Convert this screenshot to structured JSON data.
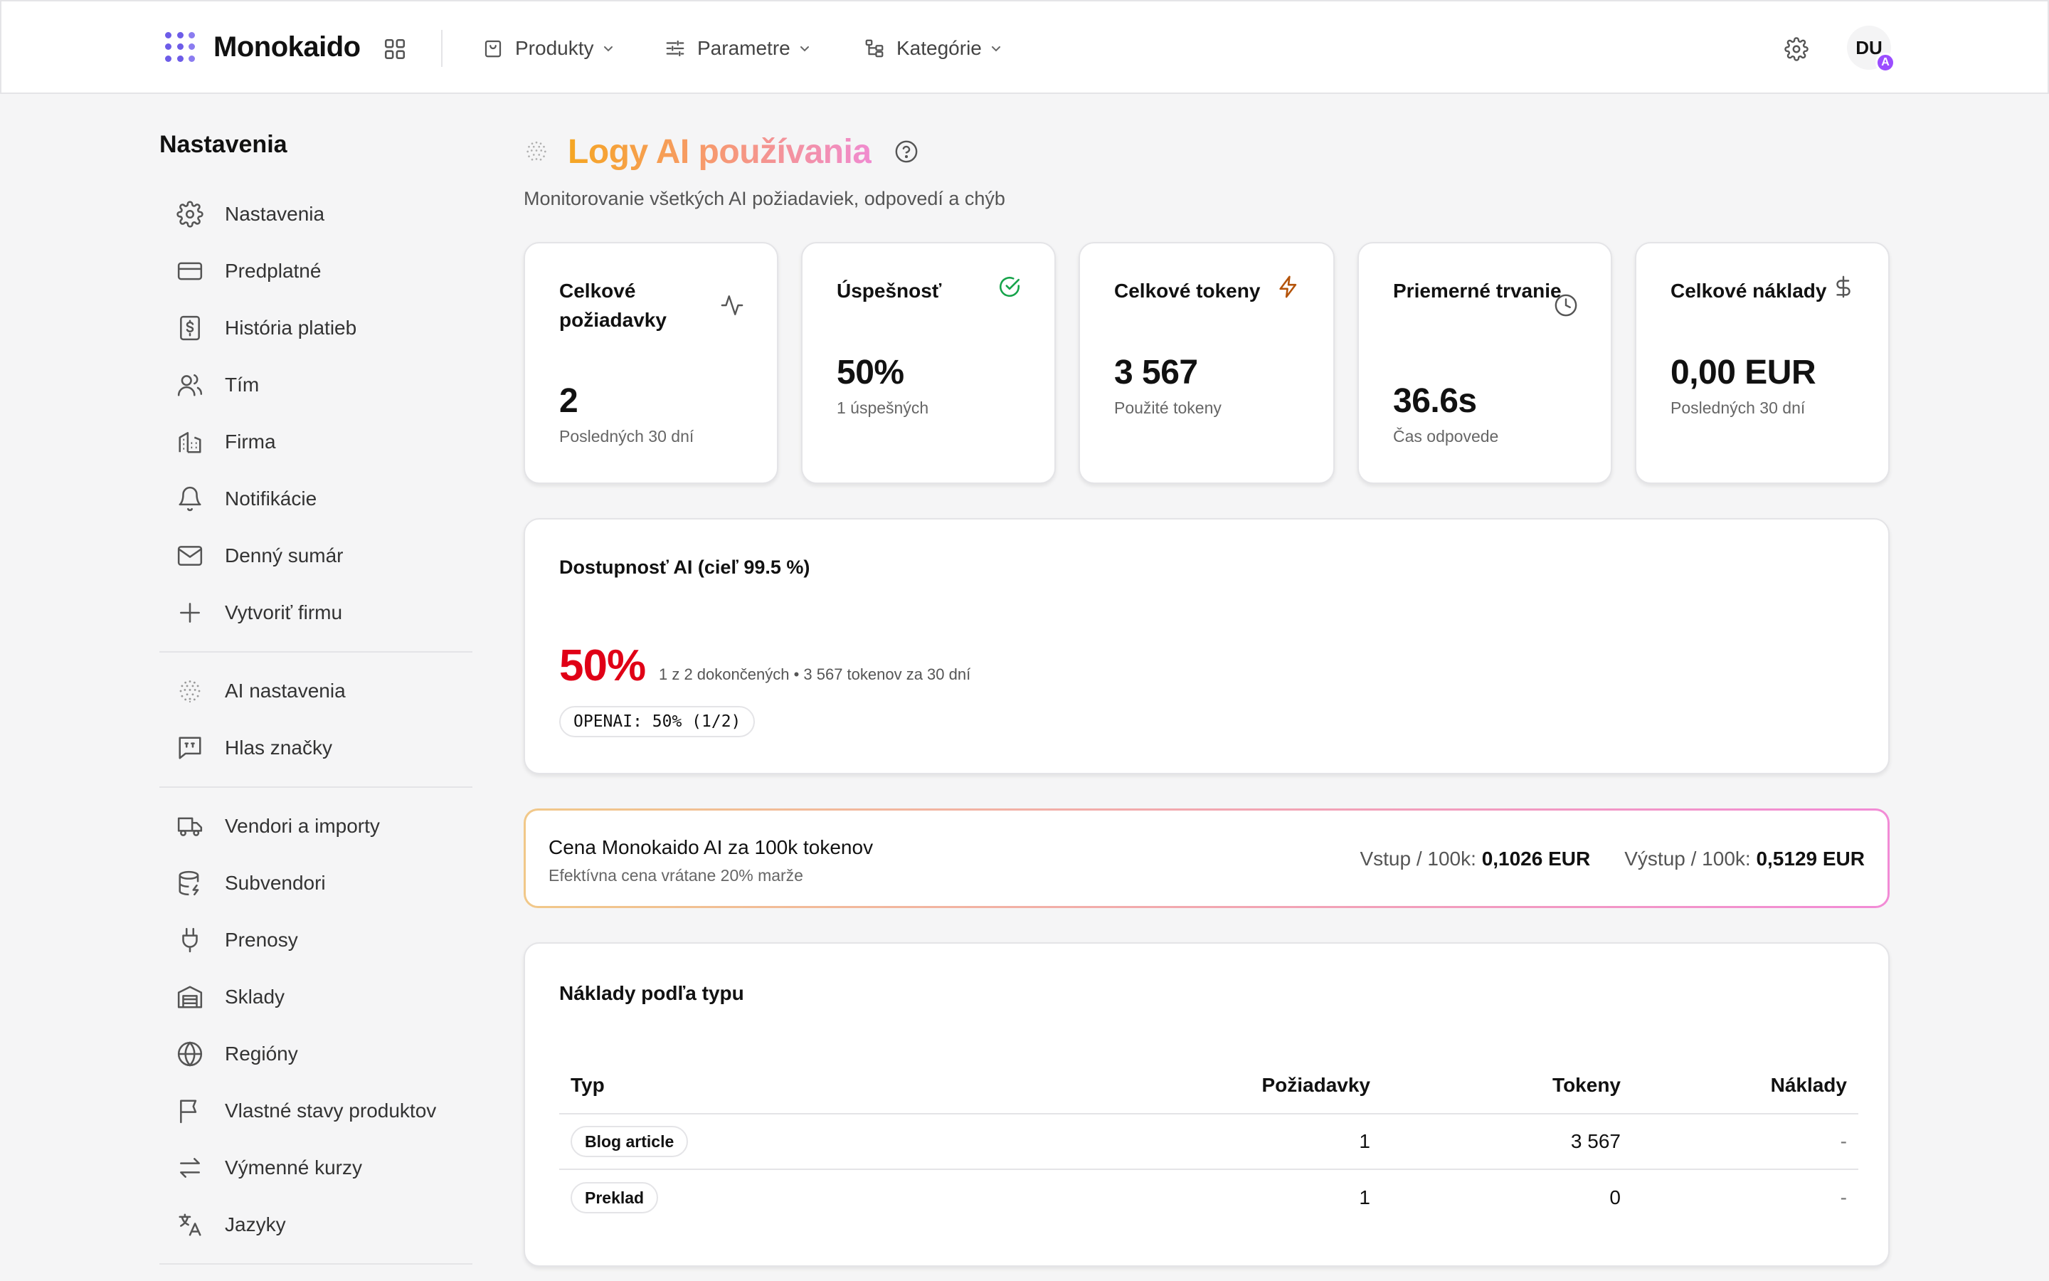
{
  "topbar": {
    "brand": "Monokaido",
    "nav": [
      {
        "label": "Produkty",
        "icon": "shopping-bag-icon"
      },
      {
        "label": "Parametre",
        "icon": "sliders-icon"
      },
      {
        "label": "Kategórie",
        "icon": "tree-icon"
      }
    ],
    "avatar_initials": "DU",
    "avatar_badge": "A"
  },
  "sidebar": {
    "title": "Nastavenia",
    "groups": [
      [
        {
          "label": "Nastavenia",
          "icon": "gear-icon"
        },
        {
          "label": "Predplatné",
          "icon": "credit-card-icon"
        },
        {
          "label": "História platieb",
          "icon": "receipt-icon"
        },
        {
          "label": "Tím",
          "icon": "users-icon"
        },
        {
          "label": "Firma",
          "icon": "building-icon"
        },
        {
          "label": "Notifikácie",
          "icon": "bell-icon"
        },
        {
          "label": "Denný sumár",
          "icon": "mail-icon"
        },
        {
          "label": "Vytvoriť firmu",
          "icon": "plus-icon"
        }
      ],
      [
        {
          "label": "AI nastavenia",
          "icon": "ai-orb-icon"
        },
        {
          "label": "Hlas značky",
          "icon": "quote-bubble-icon"
        }
      ],
      [
        {
          "label": "Vendori a importy",
          "icon": "truck-icon"
        },
        {
          "label": "Subvendori",
          "icon": "database-icon"
        },
        {
          "label": "Prenosy",
          "icon": "plug-icon"
        },
        {
          "label": "Sklady",
          "icon": "warehouse-icon"
        },
        {
          "label": "Regióny",
          "icon": "globe-icon"
        },
        {
          "label": "Vlastné stavy produktov",
          "icon": "flag-icon"
        },
        {
          "label": "Výmenné kurzy",
          "icon": "arrows-exchange-icon"
        },
        {
          "label": "Jazyky",
          "icon": "translate-icon"
        }
      ]
    ]
  },
  "page": {
    "title": "Logy AI používania",
    "subtitle": "Monitorovanie všetkých AI požiadaviek, odpovedí a chýb"
  },
  "stats": [
    {
      "label": "Celkové požiadavky",
      "value": "2",
      "hint": "Posledných 30 dní",
      "icon": "activity-icon",
      "icon_color": "#555555"
    },
    {
      "label": "Úspešnosť",
      "value": "50%",
      "hint": "1 úspešných",
      "icon": "check-circle-icon",
      "icon_color": "#16a34a"
    },
    {
      "label": "Celkové tokeny",
      "value": "3 567",
      "hint": "Použité tokeny",
      "icon": "lightning-icon",
      "icon_color": "#b45309"
    },
    {
      "label": "Priemerné trvanie",
      "value": "36.6s",
      "hint": "Čas odpovede",
      "icon": "clock-icon",
      "icon_color": "#555555"
    },
    {
      "label": "Celkové náklady",
      "value": "0,00 EUR",
      "hint": "Posledných 30 dní",
      "icon": "dollar-icon",
      "icon_color": "#555555"
    }
  ],
  "availability": {
    "title": "Dostupnosť AI (cieľ 99.5 %)",
    "percent": "50%",
    "detail": "1 z 2 dokončených • 3 567 tokenov za 30 dní",
    "provider_chip": "OPENAI: 50% (1/2)",
    "accent": "#e00016"
  },
  "pricing": {
    "title": "Cena Monokaido AI za 100k tokenov",
    "subtitle": "Efektívna cena vrátane 20% marže",
    "input_label": "Vstup / 100k:",
    "input_value": "0,1026 EUR",
    "output_label": "Výstup / 100k:",
    "output_value": "0,5129 EUR"
  },
  "costs": {
    "title": "Náklady podľa typu",
    "columns": [
      "Typ",
      "Požiadavky",
      "Tokeny",
      "Náklady"
    ],
    "rows": [
      {
        "type": "Blog article",
        "requests": "1",
        "tokens": "3 567",
        "cost": "-"
      },
      {
        "type": "Preklad",
        "requests": "1",
        "tokens": "0",
        "cost": "-"
      }
    ]
  }
}
